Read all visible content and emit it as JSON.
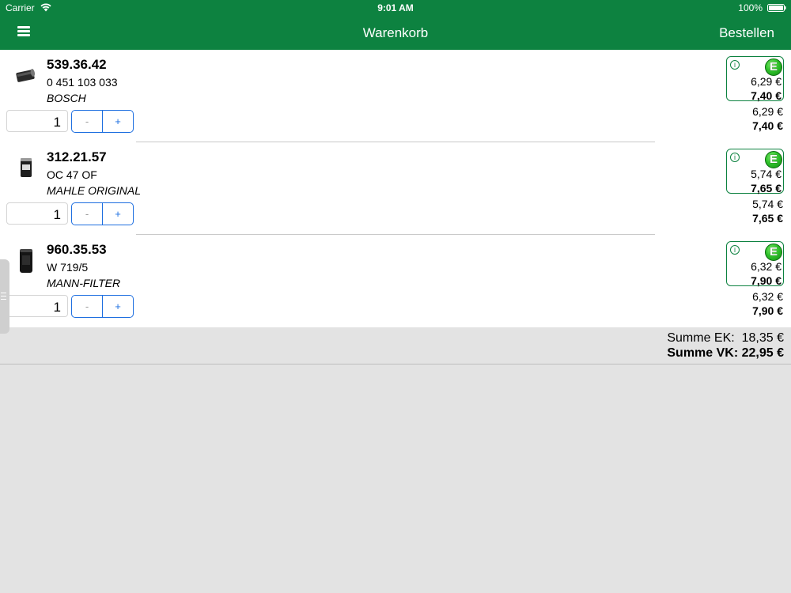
{
  "status_bar": {
    "carrier": "Carrier",
    "time": "9:01 AM",
    "battery": "100%"
  },
  "navbar": {
    "title": "Warenkorb",
    "action": "Bestellen"
  },
  "items": [
    {
      "article_no": "539.36.42",
      "oe_no": "0 451 103 033",
      "brand": "BOSCH",
      "qty": "1",
      "minus": "-",
      "plus": "+",
      "badge": "E",
      "box_ek": "6,29 €",
      "box_vk": "7,40 €",
      "ek": "6,29 €",
      "vk": "7,40 €"
    },
    {
      "article_no": "312.21.57",
      "oe_no": "OC 47 OF",
      "brand": "MAHLE ORIGINAL",
      "qty": "1",
      "minus": "-",
      "plus": "+",
      "badge": "E",
      "box_ek": "5,74 €",
      "box_vk": "7,65 €",
      "ek": "5,74 €",
      "vk": "7,65 €"
    },
    {
      "article_no": "960.35.53",
      "oe_no": "W 719/5",
      "brand": "MANN-FILTER",
      "qty": "1",
      "minus": "-",
      "plus": "+",
      "badge": "E",
      "box_ek": "6,32 €",
      "box_vk": "7,90 €",
      "ek": "6,32 €",
      "vk": "7,90 €"
    }
  ],
  "totals": {
    "sum_ek": "Summe EK:  18,35 €",
    "sum_vk": "Summe VK: 22,95 €"
  },
  "colors": {
    "accent": "#0d8240",
    "stepper": "#1e6fe0"
  }
}
